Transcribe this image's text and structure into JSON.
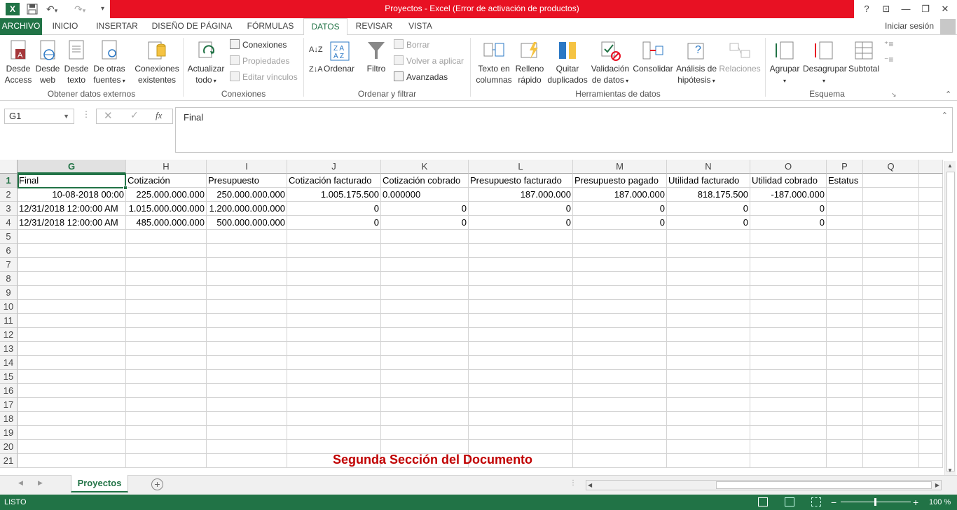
{
  "title_bar": {
    "title": "Proyectos -  Excel (Error de activación de productos)",
    "help": "?",
    "minimize": "—",
    "restore": "❐",
    "close": "✕",
    "options": "⊡"
  },
  "tabs": [
    "ARCHIVO",
    "INICIO",
    "INSERTAR",
    "DISEÑO DE PÁGINA",
    "FÓRMULAS",
    "DATOS",
    "REVISAR",
    "VISTA"
  ],
  "sign_in": "Iniciar sesión",
  "ribbon": {
    "groups": {
      "external": "Obtener datos externos",
      "connections": "Conexiones",
      "sortfilter": "Ordenar y filtrar",
      "datatools": "Herramientas de datos",
      "outline": "Esquema"
    },
    "buttons": {
      "access": [
        "Desde",
        "Access"
      ],
      "web": [
        "Desde",
        "web"
      ],
      "text": [
        "Desde",
        "texto"
      ],
      "other": [
        "De otras",
        "fuentes"
      ],
      "existing": [
        "Conexiones",
        "existentes"
      ],
      "refresh": [
        "Actualizar",
        "todo"
      ],
      "sort": "Ordenar",
      "filter": "Filtro",
      "textcols": [
        "Texto en",
        "columnas"
      ],
      "flashfill": [
        "Relleno",
        "rápido"
      ],
      "dupes": [
        "Quitar",
        "duplicados"
      ],
      "validation": [
        "Validación",
        "de datos"
      ],
      "consolidate": "Consolidar",
      "whatif": [
        "Análisis de",
        "hipótesis"
      ],
      "relations": "Relaciones",
      "group": "Agrupar",
      "ungroup": "Desagrupar",
      "subtotal": "Subtotal"
    },
    "small": {
      "connections": "Conexiones",
      "properties": "Propiedades",
      "editlinks": "Editar vínculos",
      "clear": "Borrar",
      "reapply": "Volver a aplicar",
      "advanced": "Avanzadas"
    }
  },
  "formula_bar": {
    "name_box": "G1",
    "formula": "Final"
  },
  "sheet": {
    "columns": [
      "G",
      "H",
      "I",
      "J",
      "K",
      "L",
      "M",
      "N",
      "O",
      "P",
      "Q"
    ],
    "rows": [
      [
        "Final",
        "Cotización",
        "Presupuesto",
        "Cotización facturado",
        "Cotización cobrado",
        "Presupuesto facturado",
        "Presupuesto pagado",
        "Utilidad facturado",
        "Utilidad cobrado",
        "Estatus",
        ""
      ],
      [
        "10-08-2018 00:00",
        "225.000.000.000",
        "250.000.000.000",
        "1.005.175.500",
        "0.000000",
        "187.000.000",
        "187.000.000",
        "818.175.500",
        "-187.000.000",
        "",
        ""
      ],
      [
        "12/31/2018 12:00:00 AM",
        "1.015.000.000.000",
        "1.200.000.000.000",
        "0",
        "0",
        "0",
        "0",
        "0",
        "0",
        "",
        ""
      ],
      [
        "12/31/2018 12:00:00 AM",
        "485.000.000.000",
        "500.000.000.000",
        "0",
        "0",
        "0",
        "0",
        "0",
        "0",
        "",
        ""
      ]
    ],
    "row_numbers": [
      "1",
      "2",
      "3",
      "4",
      "5",
      "6",
      "7",
      "8",
      "9",
      "10",
      "11",
      "12",
      "13",
      "14",
      "15",
      "16",
      "17",
      "18",
      "19",
      "20",
      "21"
    ],
    "watermark": "Segunda Sección del Documento"
  },
  "sheet_tab": "Proyectos",
  "status": {
    "mode": "LISTO",
    "zoom": "100 %"
  },
  "colors": {
    "accent": "#217346",
    "title_red": "#e81123",
    "watermark": "#c00000"
  }
}
